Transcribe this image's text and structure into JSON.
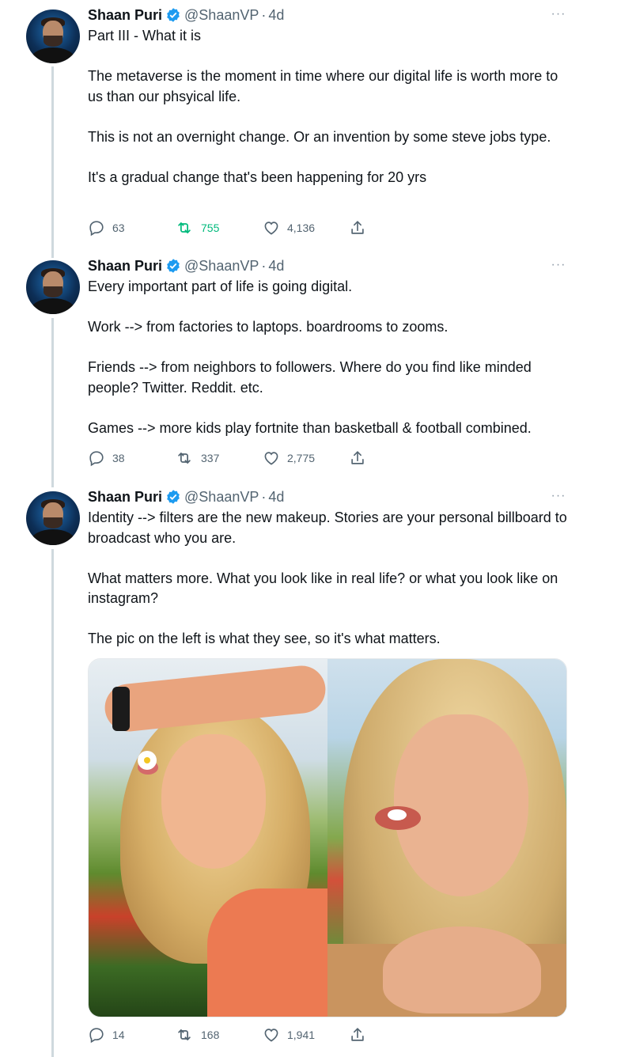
{
  "author": {
    "name": "Shaan Puri",
    "handle": "@ShaanVP",
    "separator": "·",
    "verified": true,
    "avatar_icon": "profile-avatar"
  },
  "colors": {
    "text": "#0f1419",
    "secondary": "#536471",
    "verified": "#1d9bf0",
    "retweet_active": "#00ba7c",
    "thread_line": "#cfd9de"
  },
  "tweets": [
    {
      "time": "4d",
      "paragraphs": [
        "Part III - What it is",
        "The metaverse is the moment in time where our digital life is worth more to us than our phsyical life.",
        "This is not an overnight change. Or an invention by some steve jobs type.",
        "It's a gradual change that's been happening for 20 yrs"
      ],
      "replies": "63",
      "retweets": "755",
      "retweeted": true,
      "likes": "4,136"
    },
    {
      "time": "4d",
      "paragraphs": [
        "Every important part of life is going digital.",
        "Work --> from factories to laptops. boardrooms to zooms.",
        "Friends --> from neighbors to followers. Where do you find like minded people? Twitter. Reddit. etc.",
        "Games --> more kids play fortnite than basketball & football combined."
      ],
      "replies": "38",
      "retweets": "337",
      "retweeted": false,
      "likes": "2,775"
    },
    {
      "time": "4d",
      "paragraphs": [
        "Identity --> filters are the new makeup. Stories are your personal billboard to broadcast who you are.",
        "What matters more. What you look like in real life? or what you look like on instagram?",
        "The pic on the left is what they see, so it's what matters."
      ],
      "media": [
        "filtered-photo",
        "unfiltered-photo"
      ],
      "replies": "14",
      "retweets": "168",
      "retweeted": false,
      "likes": "1,941"
    }
  ],
  "more_label": "···"
}
